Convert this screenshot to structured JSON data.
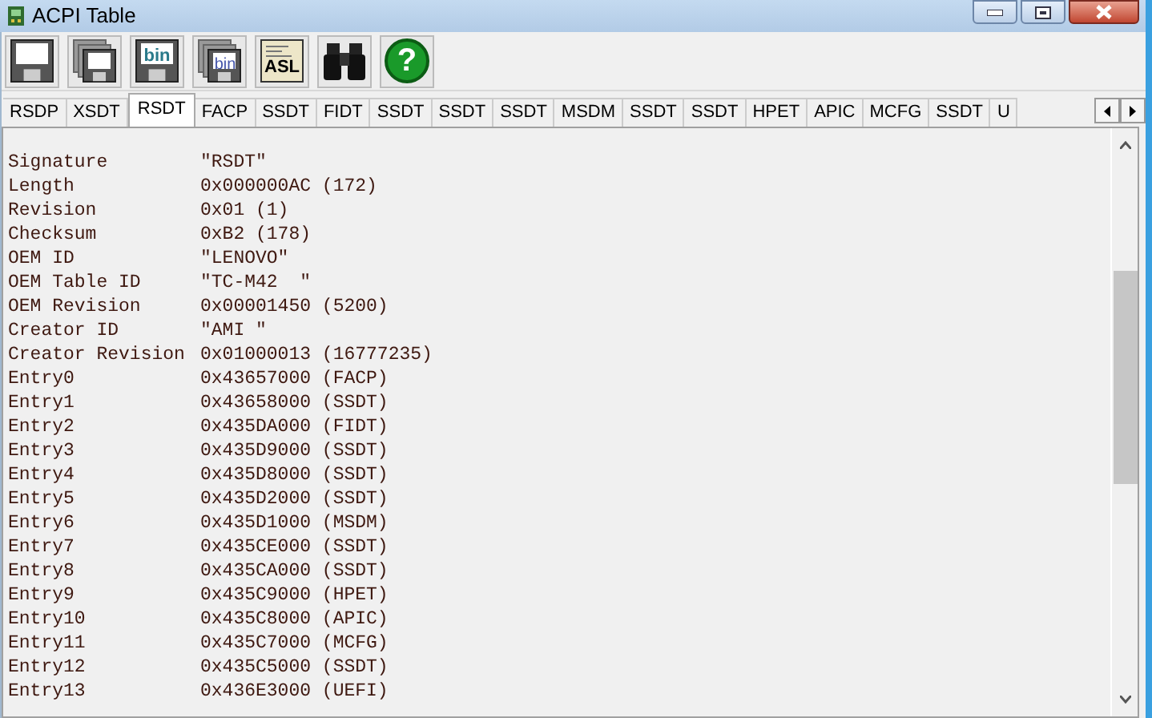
{
  "window": {
    "title": "ACPI Table"
  },
  "toolbar": [
    {
      "kind": "save"
    },
    {
      "kind": "save_all"
    },
    {
      "kind": "save_bin",
      "label": "bin"
    },
    {
      "kind": "save_all_bin",
      "label": "bin"
    },
    {
      "kind": "asl",
      "label": "ASL"
    },
    {
      "kind": "find"
    },
    {
      "kind": "help",
      "label": "?"
    }
  ],
  "tabs": [
    {
      "label": "RSDP",
      "selected": false
    },
    {
      "label": "XSDT",
      "selected": false
    },
    {
      "label": "RSDT",
      "selected": true
    },
    {
      "label": "FACP",
      "selected": false
    },
    {
      "label": "SSDT",
      "selected": false
    },
    {
      "label": "FIDT",
      "selected": false
    },
    {
      "label": "SSDT",
      "selected": false
    },
    {
      "label": "SSDT",
      "selected": false
    },
    {
      "label": "SSDT",
      "selected": false
    },
    {
      "label": "MSDM",
      "selected": false
    },
    {
      "label": "SSDT",
      "selected": false
    },
    {
      "label": "SSDT",
      "selected": false
    },
    {
      "label": "HPET",
      "selected": false
    },
    {
      "label": "APIC",
      "selected": false
    },
    {
      "label": "MCFG",
      "selected": false
    },
    {
      "label": "SSDT",
      "selected": false
    },
    {
      "label": "U",
      "selected": false
    }
  ],
  "fields": [
    {
      "name": "Signature",
      "value": "\"RSDT\""
    },
    {
      "name": "Length",
      "value": "0x000000AC (172)"
    },
    {
      "name": "Revision",
      "value": "0x01 (1)"
    },
    {
      "name": "Checksum",
      "value": "0xB2 (178)"
    },
    {
      "name": "OEM ID",
      "value": "\"LENOVO\""
    },
    {
      "name": "OEM Table ID",
      "value": "\"TC-M42  \""
    },
    {
      "name": "OEM Revision",
      "value": "0x00001450 (5200)"
    },
    {
      "name": "Creator ID",
      "value": "\"AMI \""
    },
    {
      "name": "Creator Revision",
      "value": "0x01000013 (16777235)"
    },
    {
      "name": "Entry0",
      "value": "0x43657000 (FACP)"
    },
    {
      "name": "Entry1",
      "value": "0x43658000 (SSDT)"
    },
    {
      "name": "Entry2",
      "value": "0x435DA000 (FIDT)"
    },
    {
      "name": "Entry3",
      "value": "0x435D9000 (SSDT)"
    },
    {
      "name": "Entry4",
      "value": "0x435D8000 (SSDT)"
    },
    {
      "name": "Entry5",
      "value": "0x435D2000 (SSDT)"
    },
    {
      "name": "Entry6",
      "value": "0x435D1000 (MSDM)"
    },
    {
      "name": "Entry7",
      "value": "0x435CE000 (SSDT)"
    },
    {
      "name": "Entry8",
      "value": "0x435CA000 (SSDT)"
    },
    {
      "name": "Entry9",
      "value": "0x435C9000 (HPET)"
    },
    {
      "name": "Entry10",
      "value": "0x435C8000 (APIC)"
    },
    {
      "name": "Entry11",
      "value": "0x435C7000 (MCFG)"
    },
    {
      "name": "Entry12",
      "value": "0x435C5000 (SSDT)"
    },
    {
      "name": "Entry13",
      "value": "0x436E3000 (UEFI)"
    }
  ]
}
